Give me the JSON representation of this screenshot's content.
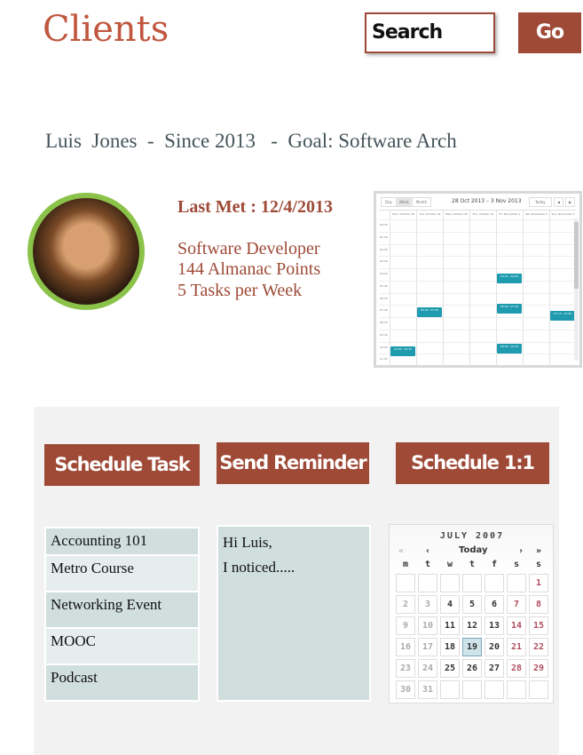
{
  "header": {
    "title": "Clients",
    "search_placeholder": "Search",
    "go_label": "Go"
  },
  "profile": {
    "name_line": "Luis  Jones  -  Since 2013   -  Goal: Software Arch",
    "last_met": "Last Met : 12/4/2013",
    "role": "Software Developer",
    "points": "144 Almanac Points",
    "tasks": "5 Tasks per Week"
  },
  "calendar_preview": {
    "views": [
      "Day",
      "Week",
      "Month"
    ],
    "range": "28 Oct 2013 – 3 Nov 2013",
    "today": "Today",
    "prev": "◀",
    "next": "▶",
    "days": [
      "Mon, October 28",
      "Tue, October 29",
      "Wed, October 30",
      "Thu, October 31",
      "Fri, November 1",
      "Sat, November 2",
      "Sun, November 3"
    ],
    "hours": [
      "00:30",
      "01:30",
      "02:30",
      "03:30",
      "04:30",
      "05:30",
      "06:30",
      "07:30",
      "08:30",
      "09:30",
      "10:30",
      "11:30"
    ],
    "events": [
      {
        "day": 4,
        "hour": 4.4,
        "label": "03:20 - 04:00"
      },
      {
        "day": 1,
        "hour": 7.2,
        "label": "05:20 - 07:45"
      },
      {
        "day": 4,
        "hour": 6.9,
        "label": "06:40 - 07:30"
      },
      {
        "day": 6,
        "hour": 7.5,
        "label": "07:15 - 07:50"
      },
      {
        "day": 4,
        "hour": 10.2,
        "label": "09:30 - 10:45"
      },
      {
        "day": 0,
        "hour": 10.4,
        "label": "10:45 - 10:30"
      }
    ]
  },
  "actions": {
    "schedule_task": "Schedule Task",
    "send_reminder": "Send Reminder",
    "schedule_1on1": "Schedule 1:1"
  },
  "tasks": [
    "Accounting 101",
    "Metro Course",
    "Networking Event",
    "MOOC",
    "Podcast"
  ],
  "reminder": {
    "line1": "Hi Luis,",
    "line2": "I noticed....."
  },
  "datepicker": {
    "month": "JULY 2007",
    "today": "Today",
    "nav": [
      "«",
      "‹",
      "›",
      "»"
    ],
    "weekdays": [
      "m",
      "t",
      "w",
      "t",
      "f",
      "s",
      "s"
    ],
    "weeks": [
      [
        "",
        "",
        "",
        "",
        "",
        "",
        "1"
      ],
      [
        "2",
        "3",
        "4",
        "5",
        "6",
        "7",
        "8"
      ],
      [
        "9",
        "10",
        "11",
        "12",
        "13",
        "14",
        "15"
      ],
      [
        "16",
        "17",
        "18",
        "19",
        "20",
        "21",
        "22"
      ],
      [
        "23",
        "24",
        "25",
        "26",
        "27",
        "28",
        "29"
      ],
      [
        "30",
        "31",
        "",
        "",
        "",
        "",
        ""
      ]
    ],
    "selected": "19"
  }
}
